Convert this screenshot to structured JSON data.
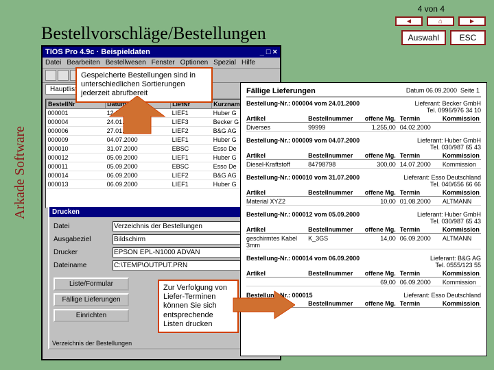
{
  "page": {
    "counter": "4 von 4",
    "title": "Bestellvorschläge/Bestellungen",
    "auswahl": "Auswahl",
    "esc": "ESC",
    "brand": "Arkade Software"
  },
  "app": {
    "title": "TIOS Pro 4.9c · Beispieldaten",
    "menu": [
      "Datei",
      "Bearbeiten",
      "Bestellwesen",
      "Fenster",
      "Optionen",
      "Spezial",
      "Hilfe"
    ],
    "tab": "Hauptliste",
    "cols": [
      "BestellNr",
      "Datum",
      "LiefNr",
      "Kurzname"
    ],
    "rows": [
      [
        "000001",
        "12.01.2000",
        "LIEF1",
        "Huber G"
      ],
      [
        "000004",
        "24.01.2000",
        "LIEF3",
        "Becker G"
      ],
      [
        "000006",
        "27.01.2000",
        "LIEF2",
        "B&G AG"
      ],
      [
        "000009",
        "04.07.2000",
        "LIEF1",
        "Huber G"
      ],
      [
        "000010",
        "31.07.2000",
        "EBSC",
        "Esso De"
      ],
      [
        "000012",
        "05.09.2000",
        "LIEF1",
        "Huber G"
      ],
      [
        "000011",
        "05.09.2000",
        "EBSC",
        "Esso De"
      ],
      [
        "000014",
        "06.09.2000",
        "LIEF2",
        "B&G AG"
      ],
      [
        "000013",
        "06.09.2000",
        "LIEF1",
        "Huber G"
      ]
    ]
  },
  "print": {
    "title": "Drucken",
    "path_label": "Datei",
    "path_value": "Verzeichnis der Bestellungen",
    "out_label": "Ausgabeziel",
    "out_value": "Bildschirm",
    "printer_label": "Drucker",
    "printer_value": "EPSON EPL-N1000 ADVAN",
    "file_label": "Dateiname",
    "file_value": "C:\\TEMP\\OUTPUT.PRN",
    "btn1": "Liste/Formular",
    "btn2": "Fällige Lieferungen",
    "btn3": "Einrichten",
    "footer": "Verzeichnis der Bestellungen"
  },
  "report": {
    "title": "Fällige Lieferungen",
    "date": "Datum 06.09.2000",
    "page": "Seite 1",
    "col_artikel": "Artikel",
    "col_bnr": "Bestellnummer",
    "col_mg": "offene Mg.",
    "col_termin": "Termin",
    "col_komm": "Kommission",
    "blocks": [
      {
        "head_l": "Bestellung-Nr.: 000004   vom 24.01.2000",
        "head_r": "Lieferant: Becker GmbH",
        "head_r2": "Tel. 0996/976 34 10",
        "items": [
          {
            "a": "Diverses",
            "b": "99999",
            "m": "1.255,00",
            "t": "04.02.2000",
            "k": ""
          }
        ]
      },
      {
        "head_l": "Bestellung-Nr.: 000009   vom 04.07.2000",
        "head_r": "Lieferant: Huber GmbH",
        "head_r2": "Tel. 030/987 65 43",
        "items": [
          {
            "a": "Diesel-Kraftstoff",
            "b": "84798798",
            "m": "300,00",
            "t": "14.07.2000",
            "k": "Kommission"
          }
        ]
      },
      {
        "head_l": "Bestellung-Nr.: 000010   vom 31.07.2000",
        "head_r": "Lieferant: Esso Deutschland",
        "head_r2": "Tel. 040/656 66 66",
        "items": [
          {
            "a": "Material XYZ2",
            "b": "",
            "m": "10,00",
            "t": "01.08.2000",
            "k": "ALTMANN"
          }
        ]
      },
      {
        "head_l": "Bestellung-Nr.: 000012   vom 05.09.2000",
        "head_r": "Lieferant: Huber GmbH",
        "head_r2": "Tel. 030/987 65 43",
        "items": [
          {
            "a": "geschirmtes Kabel 3mm",
            "b": "K_3GS",
            "m": "14,00",
            "t": "06.09.2000",
            "k": "ALTMANN"
          }
        ]
      },
      {
        "head_l": "Bestellung-Nr.: 000014   vom 06.09.2000",
        "head_r": "Lieferant: B&G AG",
        "head_r2": "Tel. 0555/123 55",
        "items": [
          {
            "a": "",
            "b": "",
            "m": "69,00",
            "t": "06.09.2000",
            "k": "Kommission"
          }
        ]
      },
      {
        "head_l": "Bestellung-Nr.: 000015",
        "head_r": "Lieferant: Esso Deutschland",
        "head_r2": "",
        "items": []
      }
    ]
  },
  "callout1": "Gespeicherte Bestellungen sind in unterschiedlichen Sortierungen jederzeit abrufbereit",
  "callout2": "Zur Verfolgung von Liefer-Terminen können Sie sich entsprechende Listen drucken"
}
